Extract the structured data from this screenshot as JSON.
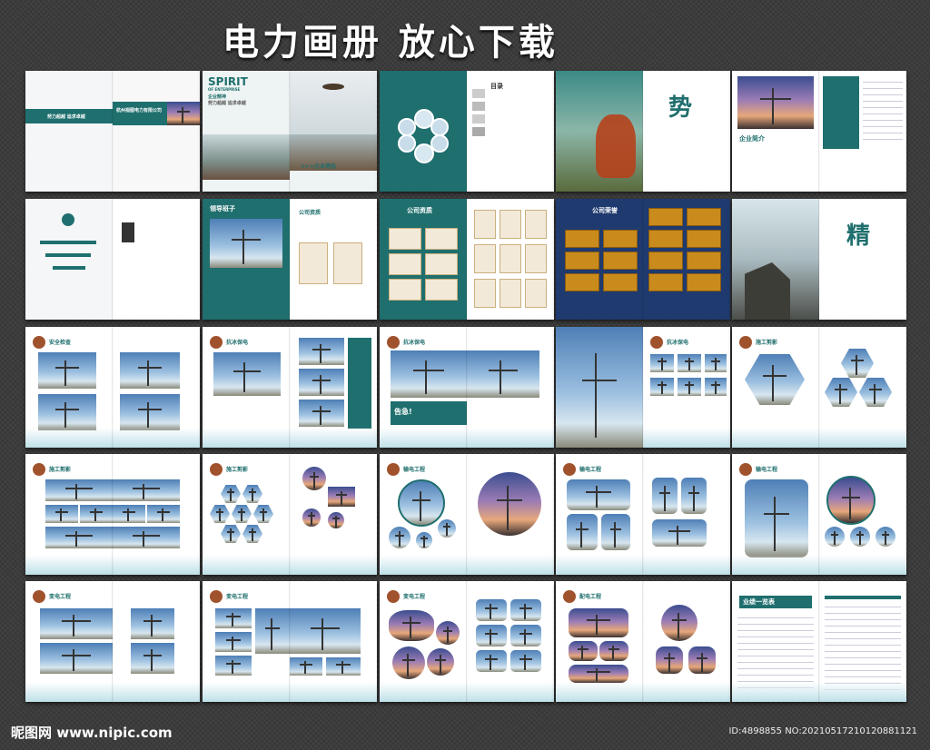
{
  "page_title": "电力画册  放心下载",
  "footer": {
    "site": "昵图网 www.nipic.com",
    "id_line": "ID:4898855 NO:20210517210120881121"
  },
  "spreads": {
    "cover_company": "杭州视图电力有限公司",
    "cover_slogan": "努力超越 追求卓越",
    "spirit_title": "SPIRIT",
    "spirit_sub": "OF ENTERPRISE",
    "spirit_cn": "企业精神",
    "spirit_motto": "努力超越 追求卓越",
    "concept_label": ">>>企业理念",
    "contents_label": "目录",
    "shi_char": "势",
    "jing_char": "精",
    "intro_label": "企业简介",
    "leader_label": "领导班子",
    "qualification_label": "公司资质",
    "honor_label": "公司荣誉",
    "safety_label": "安全检查",
    "flood_label": "抗冰保电",
    "warning_label": "告急!",
    "construction_label": "施工剪影",
    "transmission_label": "输电工程",
    "substation_label": "变电工程",
    "distribution_label": "配电工程",
    "performance_label": "业绩一览表"
  },
  "colors": {
    "accent_teal": "#1f6f6e",
    "background": "#3a3a3a",
    "gold": "#c98b1c"
  }
}
